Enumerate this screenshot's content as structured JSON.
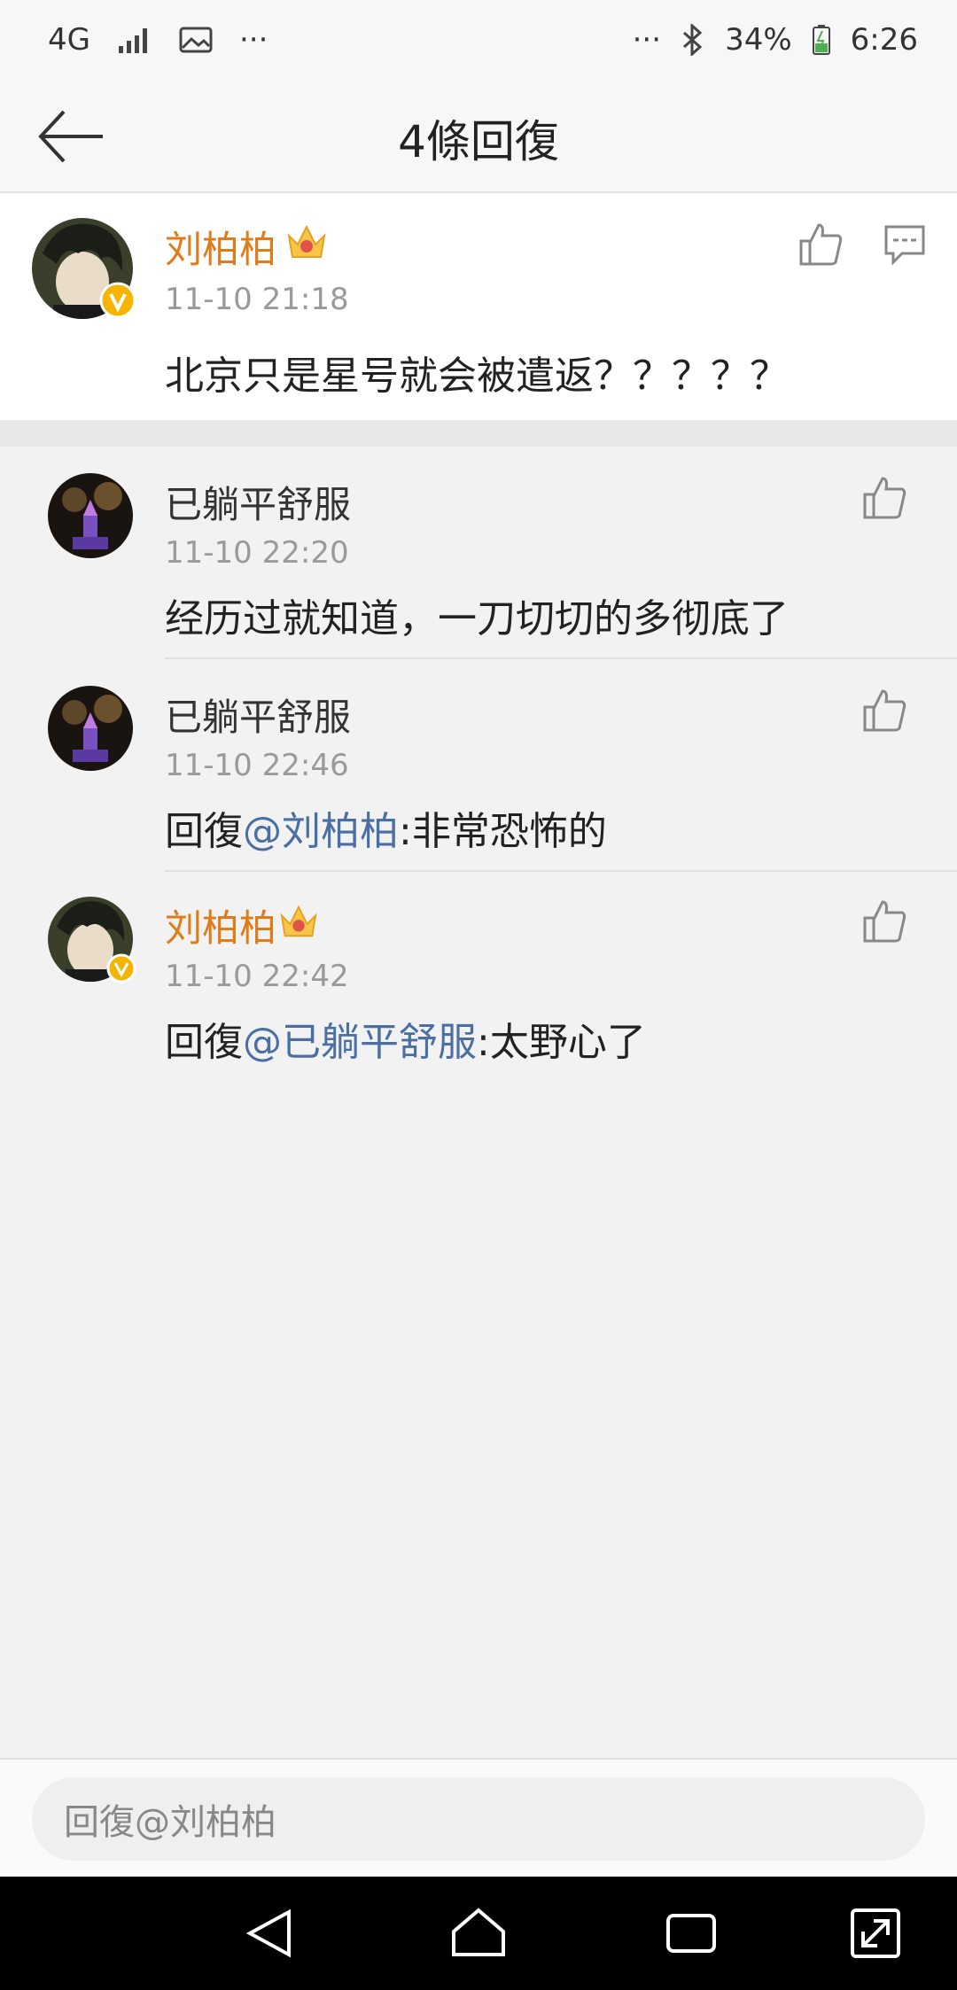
{
  "status": {
    "network": "4G",
    "battery": "34%",
    "time": "6:26",
    "dots_left": "···",
    "dots_right": "···"
  },
  "header": {
    "title": "4條回復"
  },
  "main_comment": {
    "name": "刘柏柏",
    "time": "11-10 21:18",
    "text": "北京只是星号就会被遣返？？？？？"
  },
  "replies": [
    {
      "name": "已躺平舒服",
      "time": "11-10 22:20",
      "prefix": "",
      "mention": "",
      "text": "经历过就知道，一刀切切的多彻底了"
    },
    {
      "name": "已躺平舒服",
      "time": "11-10 22:46",
      "prefix": "回復",
      "mention": "@刘柏柏",
      "text": ":非常恐怖的"
    },
    {
      "name": "刘柏柏",
      "time": "11-10 22:42",
      "prefix": "回復",
      "mention": "@已躺平舒服",
      "text": ":太野心了"
    }
  ],
  "input": {
    "placeholder": "回復@刘柏柏"
  },
  "colors": {
    "name_vip": "#e07b1a",
    "mention": "#4a6fa5",
    "badge": "#f5b400"
  }
}
